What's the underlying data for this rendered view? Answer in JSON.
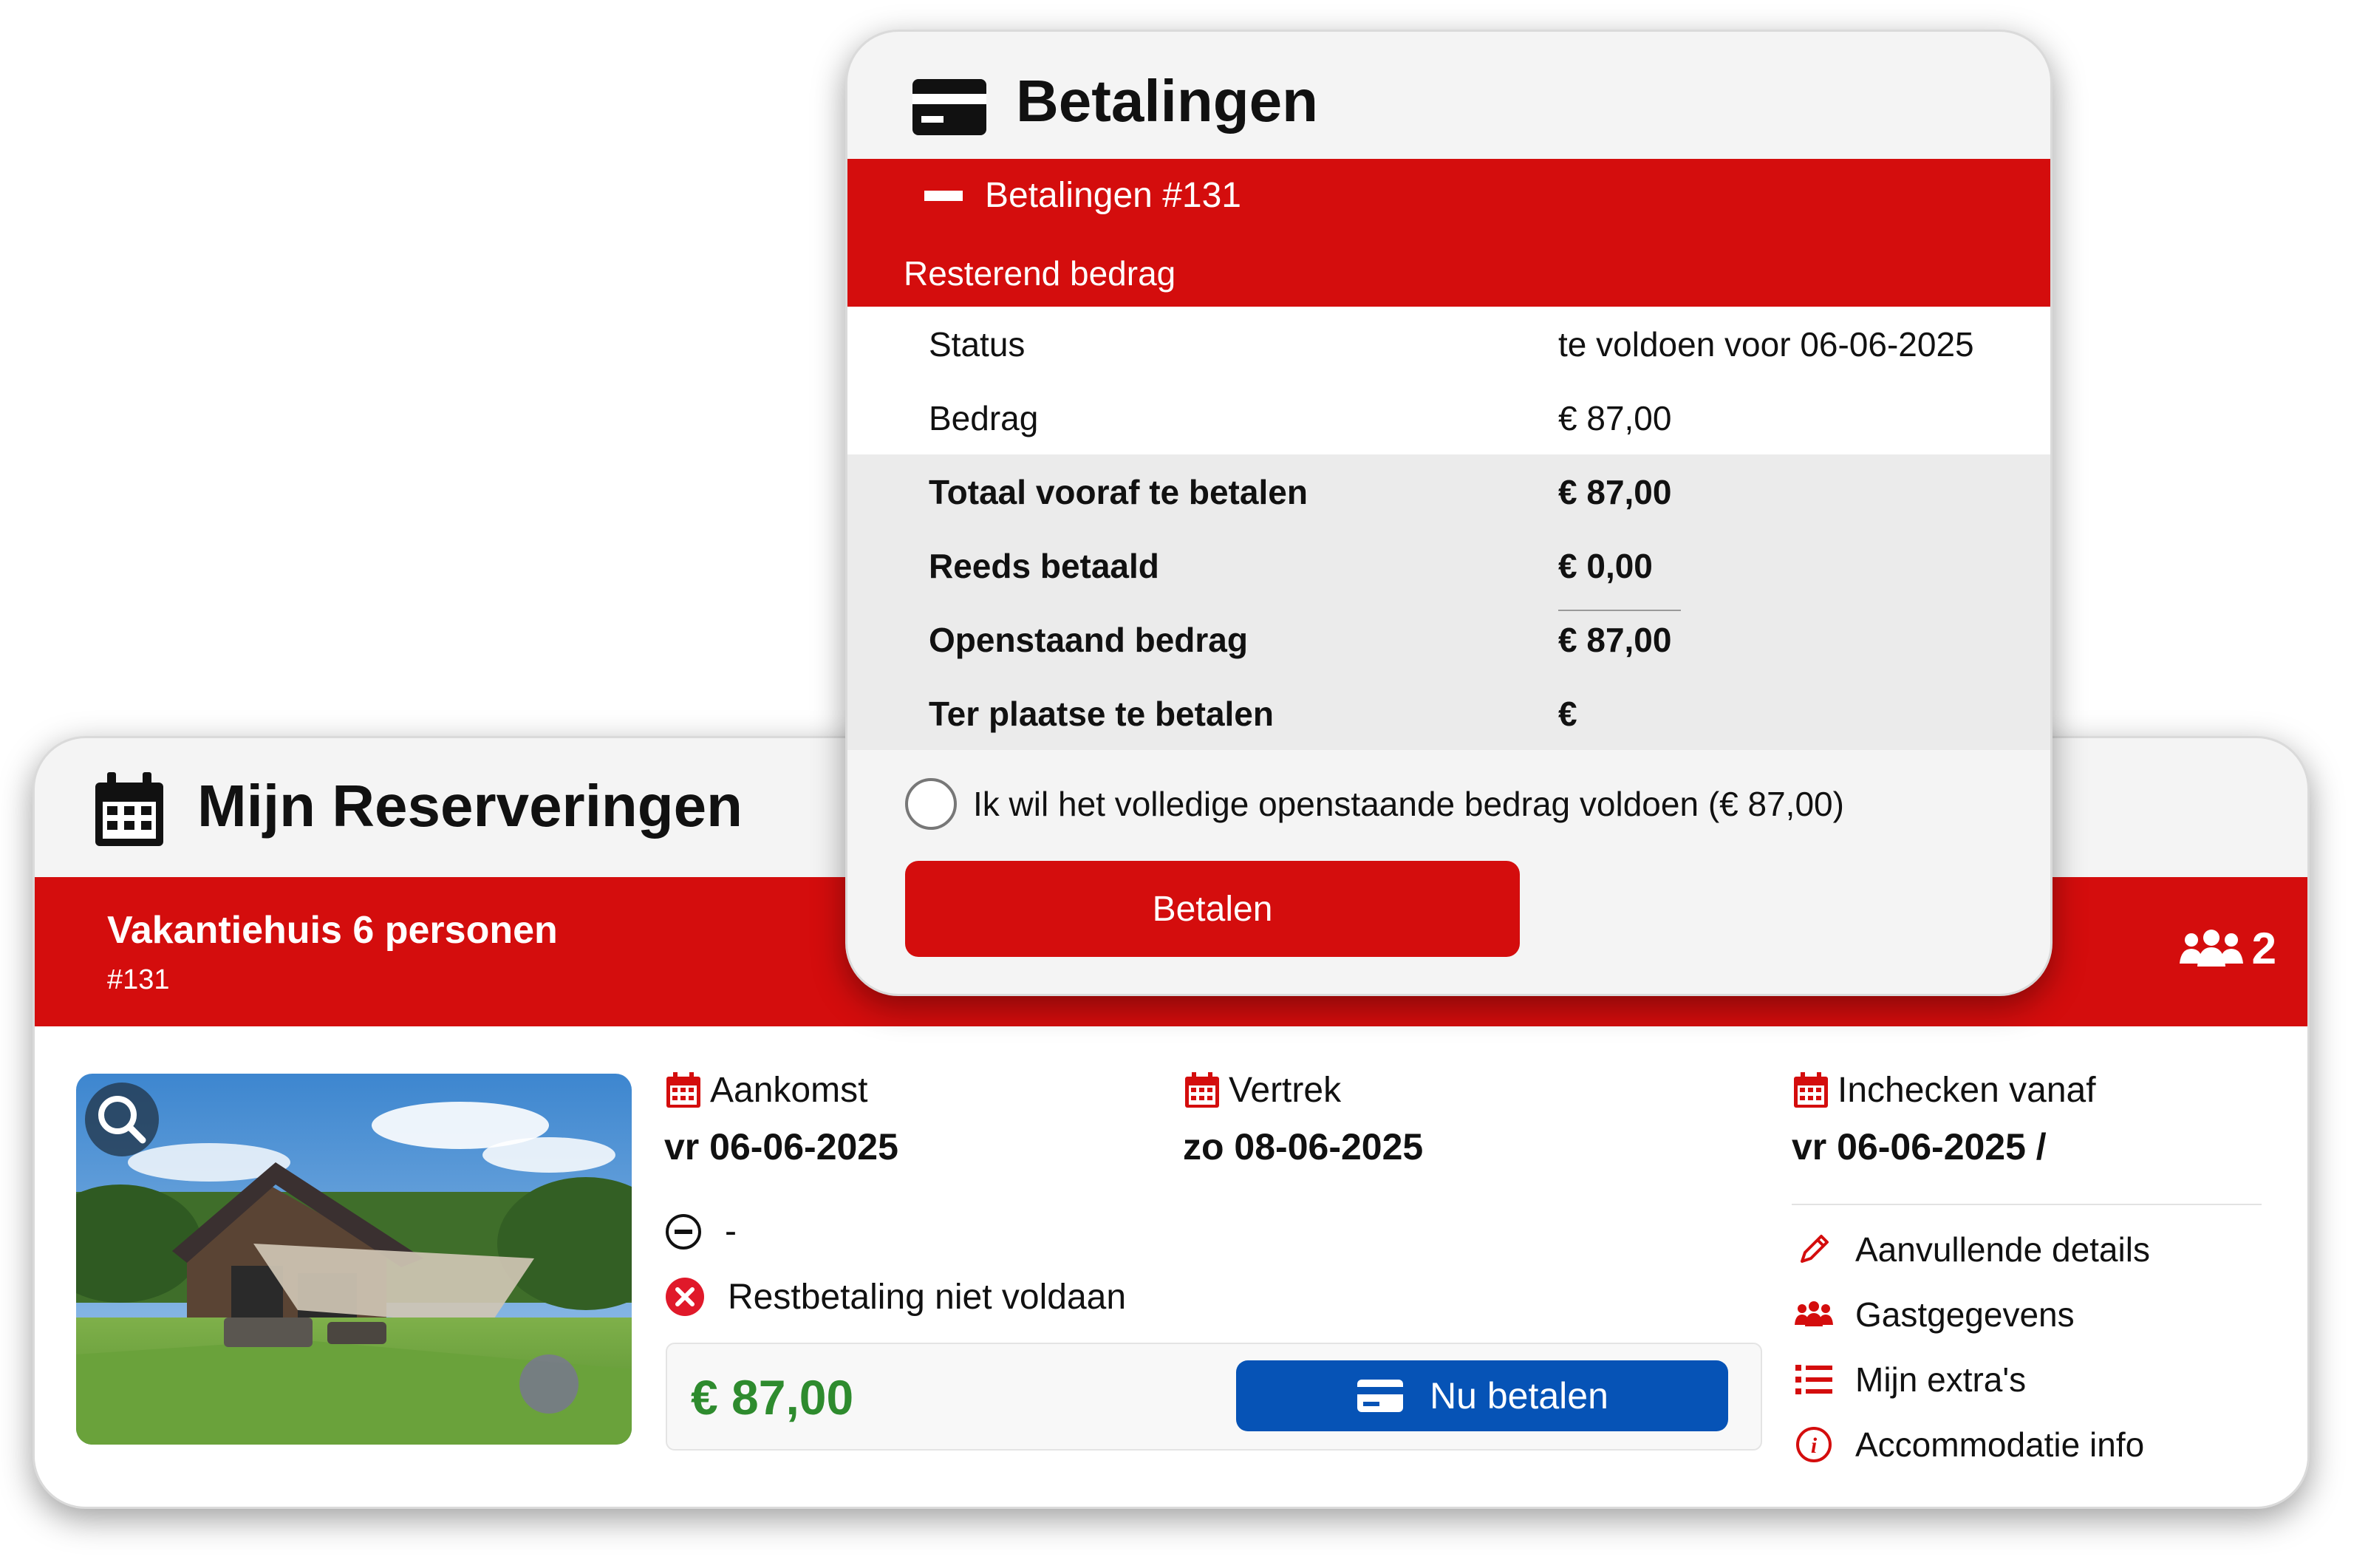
{
  "reservations": {
    "title": "Mijn Reserveringen",
    "accommodation": "Vakantiehuis 6 personen",
    "number": "#131",
    "guests": "2",
    "arrival_label": "Aankomst",
    "arrival_value": "vr 06-06-2025",
    "departure_label": "Vertrek",
    "departure_value": "zo 08-06-2025",
    "checkin_label": "Inchecken vanaf",
    "checkin_value": "vr 06-06-2025 /",
    "neutral_status": "-",
    "payment_status": "Restbetaling niet voldaan",
    "price": "€ 87,00",
    "pay_now_label": "Nu betalen",
    "menu": [
      {
        "label": "Aanvullende details",
        "icon": "pencil-icon"
      },
      {
        "label": "Gastgegevens",
        "icon": "users-icon"
      },
      {
        "label": "Mijn extra's",
        "icon": "list-icon"
      },
      {
        "label": "Accommodatie info",
        "icon": "info-icon"
      }
    ],
    "colors": {
      "brand_red": "#d40d0d",
      "pay_blue": "#0653b6",
      "price_green": "#2e8b2e"
    }
  },
  "payments": {
    "title": "Betalingen",
    "section": "Betalingen #131",
    "subheader": "Resterend bedrag",
    "rows": [
      {
        "label": "Status",
        "value": "te voldoen voor 06-06-2025"
      },
      {
        "label": "Bedrag",
        "value": "€ 87,00"
      }
    ],
    "totals": [
      {
        "label": "Totaal vooraf te betalen",
        "value": "€ 87,00"
      },
      {
        "label": "Reeds betaald",
        "value": "€ 0,00"
      },
      {
        "label": "Openstaand bedrag",
        "value": "€ 87,00"
      },
      {
        "label": "Ter plaatse te betalen",
        "value": "€"
      }
    ],
    "checkbox_label": "Ik wil het volledige openstaande bedrag voldoen (€ 87,00)",
    "pay_button": "Betalen"
  }
}
